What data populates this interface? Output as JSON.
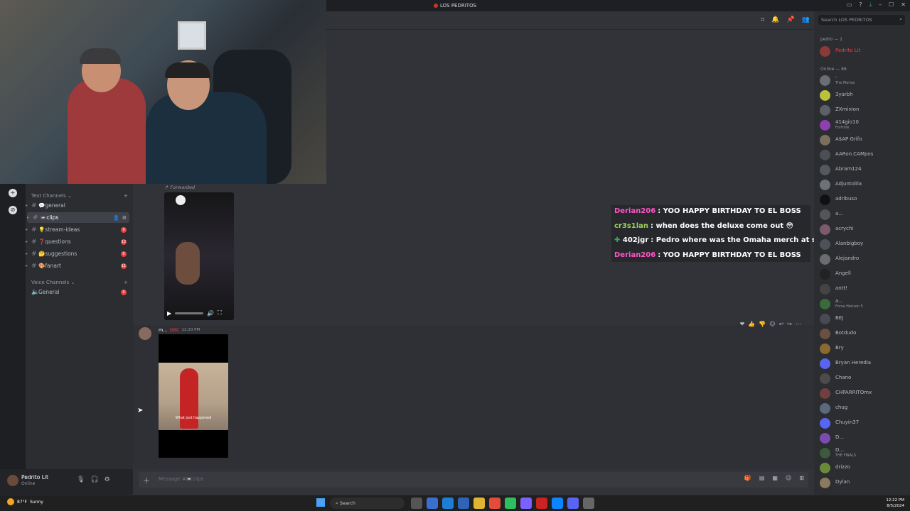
{
  "window": {
    "title": "LOS PEDRITOS"
  },
  "sidebar": {
    "text_channels_label": "Text Channels",
    "voice_channels_label": "Voice Channels",
    "channels": [
      {
        "name": "💬general",
        "badge": ""
      },
      {
        "name": "📼clips",
        "badge": ""
      },
      {
        "name": "💡stream-ideas",
        "badge": "9"
      },
      {
        "name": "❓questions",
        "badge": "12"
      },
      {
        "name": "🤔suggestions",
        "badge": "9"
      },
      {
        "name": "🎨fanart",
        "badge": "11"
      }
    ],
    "voice": [
      {
        "name": "General",
        "badge": "9"
      }
    ]
  },
  "user": {
    "name": "Pedrito Lit",
    "status": "Online"
  },
  "messages": {
    "forwarded_label": "Forwarded",
    "msg2_author": "m...",
    "msg2_tag": "OBC",
    "msg2_time": "12:20 PM",
    "video2_caption": "What just happened"
  },
  "overlay": [
    {
      "user": "Derian206",
      "text": ": YOO HAPPY BIRTHDAY TO EL BOSS",
      "color": "#ff55c8"
    },
    {
      "user": "cr3s1lan",
      "text": ": when does the deluxe come out 😳",
      "color": "#9cd15b"
    },
    {
      "user": "402jgr",
      "text": ": Pedro where was the Omaha merch at smh",
      "color": "#ffffff"
    },
    {
      "user": "Derian206",
      "text": ": YOO HAPPY BIRTHDAY TO EL BOSS",
      "color": "#ff55c8"
    }
  ],
  "composer": {
    "placeholder": "Message #📼clips"
  },
  "members": {
    "search_placeholder": "Search LOS PEDRITOS",
    "role_header": "pedro — 1",
    "role_members": [
      {
        "name": "Pedrito Lit",
        "color": "#f23f43"
      }
    ],
    "online_header": "Online — 86",
    "online": [
      {
        "name": "-",
        "sub": "The Marias"
      },
      {
        "name": "3yarbh",
        "sub": ""
      },
      {
        "name": "ZXminion",
        "sub": ""
      },
      {
        "name": "414gio10",
        "sub": "Fortnite"
      },
      {
        "name": "A$AP Grifo",
        "sub": ""
      },
      {
        "name": "AARon.CAMpos",
        "sub": ""
      },
      {
        "name": "Abram124",
        "sub": ""
      },
      {
        "name": "Adjuntolila",
        "sub": ""
      },
      {
        "name": "adribuso",
        "sub": ""
      },
      {
        "name": "a...",
        "sub": ""
      },
      {
        "name": "acrychi",
        "sub": ""
      },
      {
        "name": "Alanbigboy",
        "sub": ""
      },
      {
        "name": "Alejandro",
        "sub": ""
      },
      {
        "name": "Angell",
        "sub": ""
      },
      {
        "name": "antt!",
        "sub": ""
      },
      {
        "name": "a...",
        "sub": "Forza Horizon 5"
      },
      {
        "name": "BEJ",
        "sub": ""
      },
      {
        "name": "Botdudo",
        "sub": ""
      },
      {
        "name": "Bry",
        "sub": ""
      },
      {
        "name": "Bryan Heredia",
        "sub": ""
      },
      {
        "name": "Chano",
        "sub": ""
      },
      {
        "name": "CHPARRITOmx",
        "sub": ""
      },
      {
        "name": "chug",
        "sub": ""
      },
      {
        "name": "Chuyin37",
        "sub": ""
      },
      {
        "name": "D...",
        "sub": ""
      },
      {
        "name": "D...",
        "sub": "THE FINALS"
      },
      {
        "name": "drizzo",
        "sub": ""
      },
      {
        "name": "Dylan",
        "sub": ""
      }
    ]
  },
  "taskbar": {
    "weather_temp": "87°F",
    "weather_text": "Sunny",
    "search_label": "Search",
    "time": "12:22 PM",
    "date": "8/5/2024"
  }
}
